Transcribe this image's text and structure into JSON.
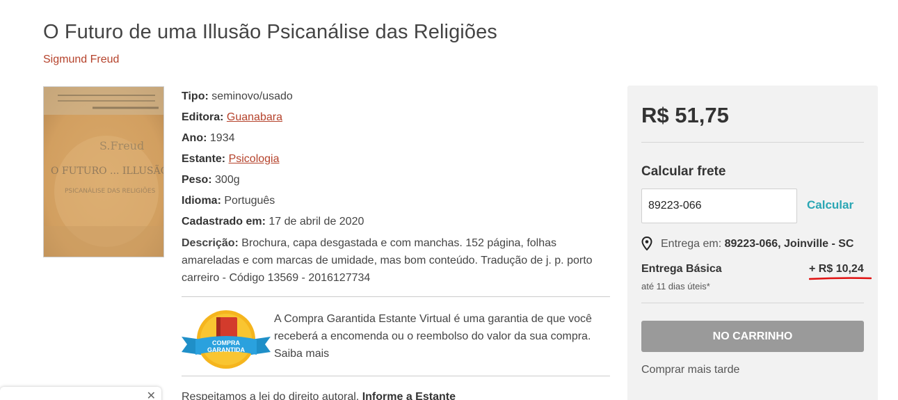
{
  "book": {
    "title": "O Futuro de uma Illusão Psicanálise das Religiões",
    "author": "Sigmund Freud"
  },
  "details": {
    "tipo_label": "Tipo:",
    "tipo_value": "seminovo/usado",
    "editora_label": "Editora:",
    "editora_value": "Guanabara",
    "ano_label": "Ano:",
    "ano_value": "1934",
    "estante_label": "Estante:",
    "estante_value": "Psicologia",
    "peso_label": "Peso:",
    "peso_value": "300g",
    "idioma_label": "Idioma:",
    "idioma_value": "Português",
    "cadastrado_label": "Cadastrado em:",
    "cadastrado_value": "17 de abril de 2020",
    "descricao_label": "Descrição:",
    "descricao_value": "Brochura, capa desgastada e com manchas. 152 página, folhas amareladas e com marcas de umidade, mas bom conteúdo. Tradução de j. p. porto carreiro - Código 13569 - 2016127734"
  },
  "guarantee": {
    "badge_line1": "COMPRA",
    "badge_line2": "GARANTIDA",
    "text": "A Compra Garantida Estante Virtual é uma garantia de que você receberá a encomenda ou o reembolso do valor da sua compra. Saiba mais"
  },
  "copyright": {
    "text": "Respeitamos a lei do direito autoral.",
    "link": "Informe a Estante"
  },
  "sidebar": {
    "price": "R$ 51,75",
    "frete_title": "Calcular frete",
    "cep_value": "89223-066",
    "calcular_label": "Calcular",
    "entrega_prefix": "Entrega em:",
    "entrega_location": "89223-066, Joinville - SC",
    "shipping_name": "Entrega Básica",
    "shipping_time": "até 11 dias úteis*",
    "shipping_price": "+ R$ 10,24",
    "cart_button": "NO CARRINHO",
    "later_link": "Comprar mais tarde"
  },
  "colors": {
    "accent_link": "#b5422b",
    "calc_link": "#2aa6b4",
    "cart_button_bg": "#9a9a9a",
    "annotation_red": "#e01010"
  },
  "icons": {
    "location": "location-pin-icon",
    "chevron": "chevron-down-icon"
  }
}
